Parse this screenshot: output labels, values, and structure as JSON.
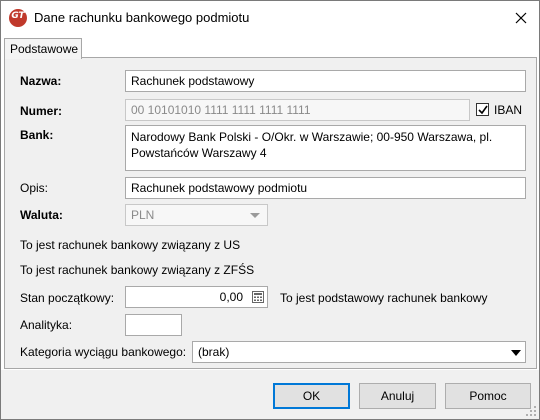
{
  "window": {
    "title": "Dane rachunku bankowego podmiotu",
    "app_icon_text": "GT"
  },
  "tabs": [
    {
      "label": "Podstawowe"
    }
  ],
  "form": {
    "nazwa_label": "Nazwa:",
    "nazwa_value": "Rachunek podstawowy",
    "numer_label": "Numer:",
    "numer_value": "00 10101010 1111 1111 1111 1111",
    "iban_label": "IBAN",
    "iban_checked": true,
    "bank_label": "Bank:",
    "bank_value": "Narodowy Bank Polski  - O/Okr. w Warszawie; 00-950 Warszawa, pl. Powstańców Warszawy 4",
    "opis_label": "Opis:",
    "opis_value": "Rachunek podstawowy podmiotu",
    "waluta_label": "Waluta:",
    "waluta_value": "PLN",
    "us_text": "To jest rachunek bankowy związany z US",
    "zfss_text": "To jest rachunek bankowy związany z ZFŚS",
    "stan_label": "Stan początkowy:",
    "stan_value": "0,00",
    "podstawowy_text": "To jest podstawowy rachunek bankowy",
    "analityka_label": "Analityka:",
    "analityka_value": "",
    "kategoria_label": "Kategoria wyciągu bankowego:",
    "kategoria_value": "(brak)"
  },
  "buttons": {
    "ok": "OK",
    "cancel": "Anuluj",
    "help": "Pomoc"
  },
  "colors": {
    "app_icon": "#c0392b",
    "default_button_border": "#0078d7",
    "panel_bg": "#f0f0f0"
  }
}
